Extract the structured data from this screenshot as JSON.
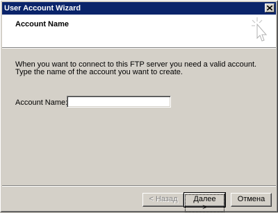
{
  "window": {
    "title": "User Account Wizard"
  },
  "header": {
    "title": "Account Name",
    "icon": "wizard-sparkle-icon"
  },
  "body": {
    "description_line1": "When you want to connect to this FTP server you need a valid account.",
    "description_line2": "Type the name of the account you want to create.",
    "account_name_label": "Account Name:",
    "account_name_value": ""
  },
  "buttons": {
    "back": "< Назад",
    "next": "Далее >",
    "cancel": "Отмена"
  },
  "colors": {
    "titlebar": "#0a246a",
    "face": "#d4d0c8",
    "header_bg": "#ffffff"
  }
}
